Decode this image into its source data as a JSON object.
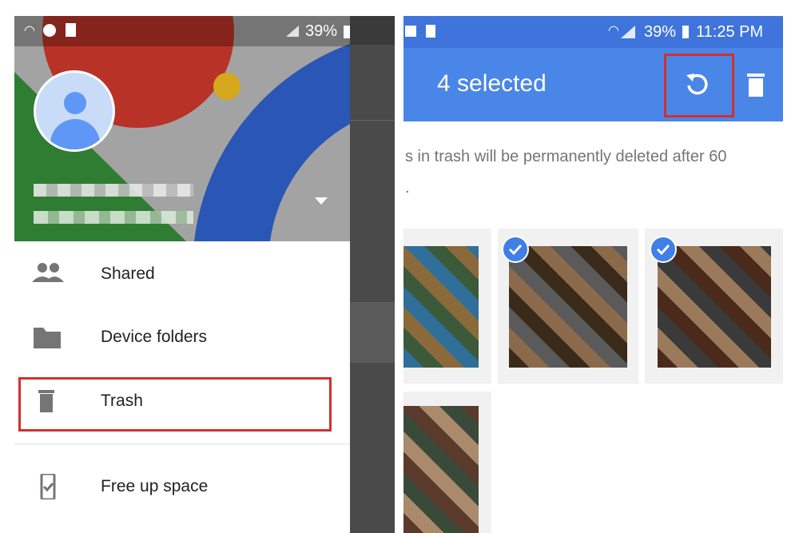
{
  "left": {
    "status_bar": {
      "battery": "39%",
      "time": "11:2"
    },
    "drawer_items": [
      {
        "label": "Shared",
        "icon": "people-icon"
      },
      {
        "label": "Device folders",
        "icon": "folder-icon"
      },
      {
        "label": "Trash",
        "icon": "trash-icon",
        "highlighted": true
      },
      {
        "label": "Free up space",
        "icon": "phone-check-icon"
      }
    ]
  },
  "right": {
    "status_bar": {
      "battery": "39%",
      "time": "11:25 PM"
    },
    "app_bar": {
      "title": "4 selected"
    },
    "notice": {
      "line1": "s in trash will be permanently deleted after 60",
      "line2": "."
    },
    "photos": [
      {
        "selected": false
      },
      {
        "selected": true
      },
      {
        "selected": true
      },
      {
        "selected": false
      }
    ]
  },
  "colors": {
    "app_bar": "#4a86e8",
    "status_bar": "#3f74dc",
    "highlight_box": "#d32f2f",
    "check_badge": "#3f7fe6"
  }
}
